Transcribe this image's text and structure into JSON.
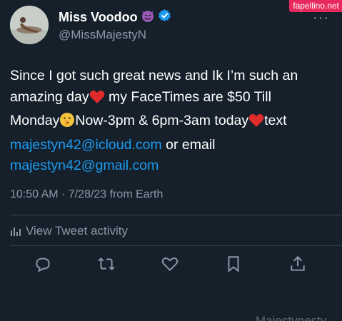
{
  "watermark": "fapellino.net",
  "author": {
    "display_name": "Miss Voodoo",
    "handle": "@MissMajestyN",
    "name_emoji": "smiling-imp-emoji",
    "verified_badge": "verified-badge-icon"
  },
  "tweet": {
    "line1": "Since I got such great news and Ik I’m such an",
    "line2_a": "amazing day",
    "line2_b": " my FaceTimes are $50 Till",
    "line3_a": "Monday",
    "line3_b": "Now-3pm & 6pm-3am today",
    "line3_c": "text",
    "email1": "majestyn42@icloud.com",
    "or_email": " or email",
    "email2": "majestyn42@gmail.com"
  },
  "meta": {
    "timestamp": "10:50 AM · 7/28/23 from Earth"
  },
  "activity": {
    "label": "View Tweet activity"
  },
  "actions": [
    "reply-icon",
    "retweet-icon",
    "like-icon",
    "bookmark-icon",
    "share-icon"
  ],
  "footer_partial": "Majestynesty",
  "colors": {
    "background": "#15202b",
    "link": "#1d9bf0",
    "secondary_text": "#8b98a5",
    "verified": "#1d9bf0",
    "watermark": "#e8295d"
  }
}
